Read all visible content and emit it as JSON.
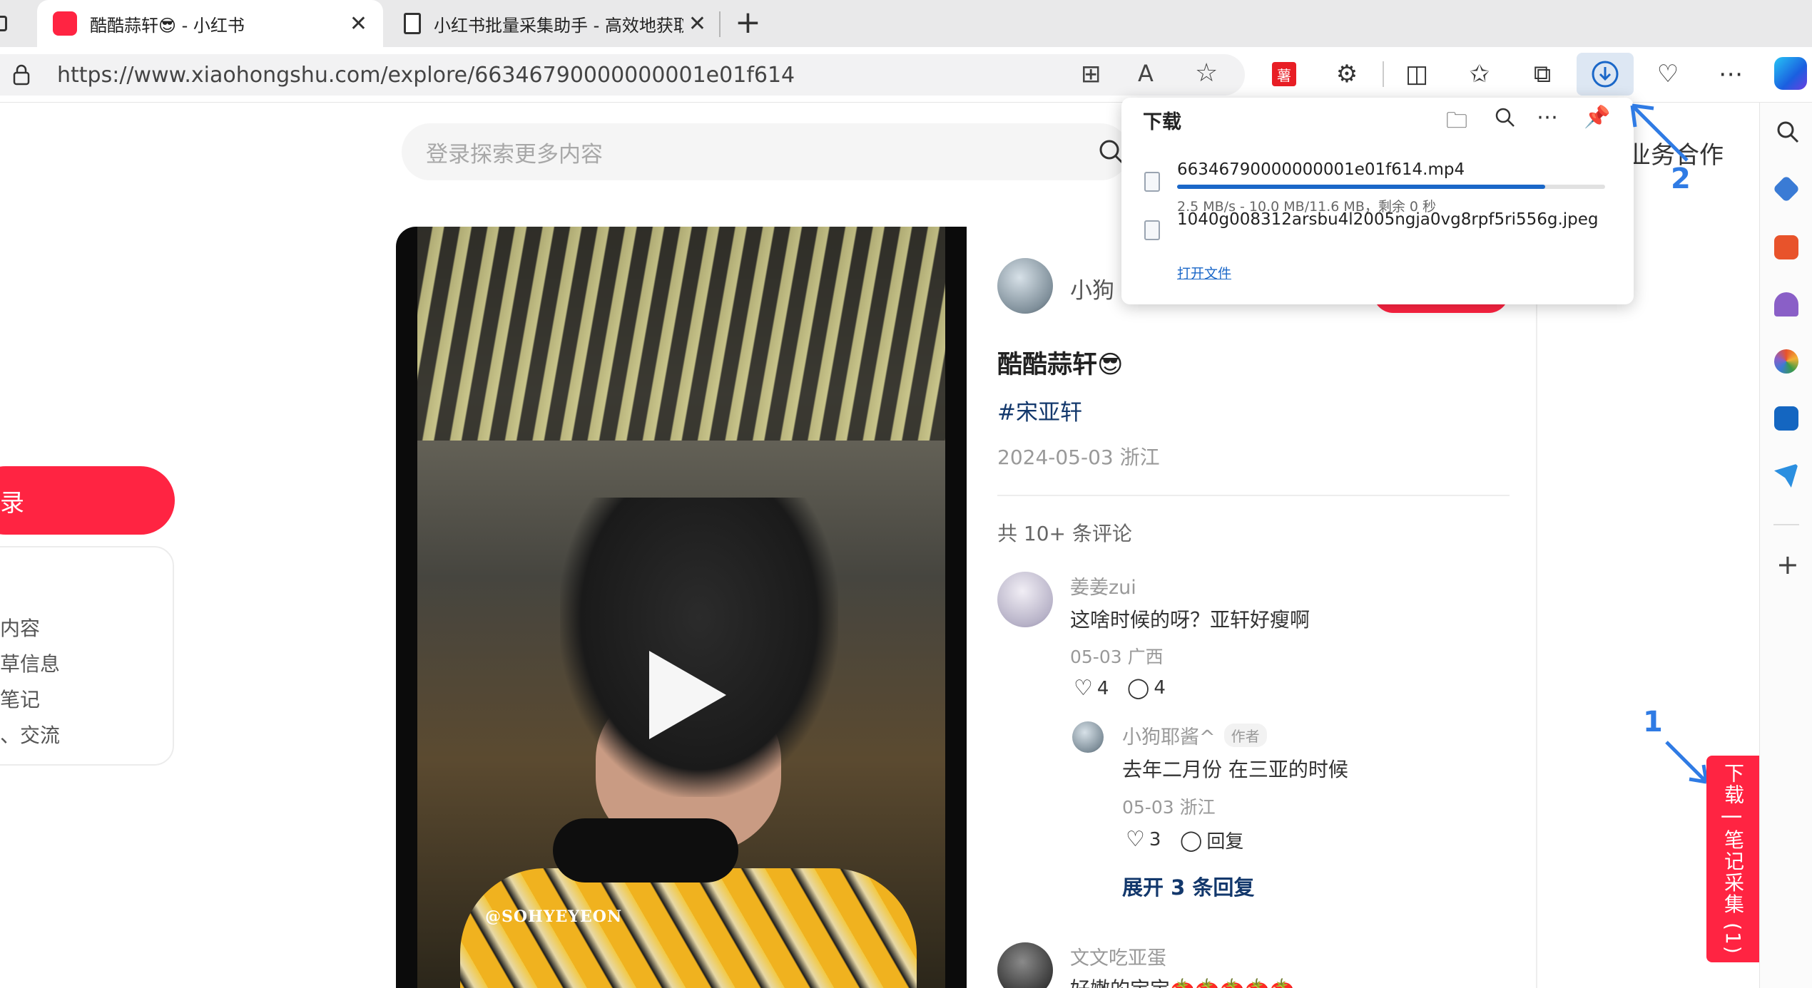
{
  "browser": {
    "tabs": [
      {
        "title": "酷酷蒜轩😎 - 小红书",
        "favicon": "xiaohongshu-logo",
        "active": true
      },
      {
        "title": "小红书批量采集助手 - 高效地获取",
        "favicon": "page-icon",
        "active": false
      }
    ],
    "url": "https://www.xiaohongshu.com/explore/66346790000000001e01f614"
  },
  "page": {
    "search_placeholder": "登录探索更多内容",
    "business_link": "业务合作",
    "login_button": "录",
    "sidebar_features": [
      "质内容",
      "拔草信息",
      "的笔记",
      "动、交流"
    ],
    "video_watermark": "@SOHYEYEON"
  },
  "note": {
    "author_partial": "小狗",
    "title": "酷酷蒜轩😎",
    "tag": "#宋亚轩",
    "date_location": "2024-05-03 浙江",
    "comment_count": "共 10+ 条评论",
    "comments": [
      {
        "user": "姜姜zui",
        "text": "这啥时候的呀？亚轩好瘦啊",
        "meta": "05-03 广西",
        "likes": "4",
        "replies": "4",
        "reply": {
          "user": "小狗耶酱^",
          "badge": "作者",
          "text": "去年二月份 在三亚的时候",
          "meta": "05-03 浙江",
          "likes": "3",
          "reply_label": "回复"
        }
      },
      {
        "user": "文文吃亚蛋",
        "text": "好嫩的宝宝🍅🍅🍅🍅🍅"
      }
    ],
    "expand_replies": "展开 3 条回复"
  },
  "downloads": {
    "title": "下载",
    "items": [
      {
        "filename": "66346790000000001e01f614.mp4",
        "status": "2.5 MB/s - 10.0 MB/11.6 MB，剩余 0 秒",
        "progress": 0.86
      },
      {
        "filename": "1040g008312arsbu4l2005ngja0vg8rpf5ri556g.jpeg",
        "action": "打开文件"
      }
    ]
  },
  "extension_button": "下载 | 笔记采集 (1)",
  "annotations": {
    "one": "1",
    "two": "2"
  },
  "colors": {
    "brand": "#ff2442",
    "accent_blue": "#2f7be4",
    "link": "#13386c"
  }
}
